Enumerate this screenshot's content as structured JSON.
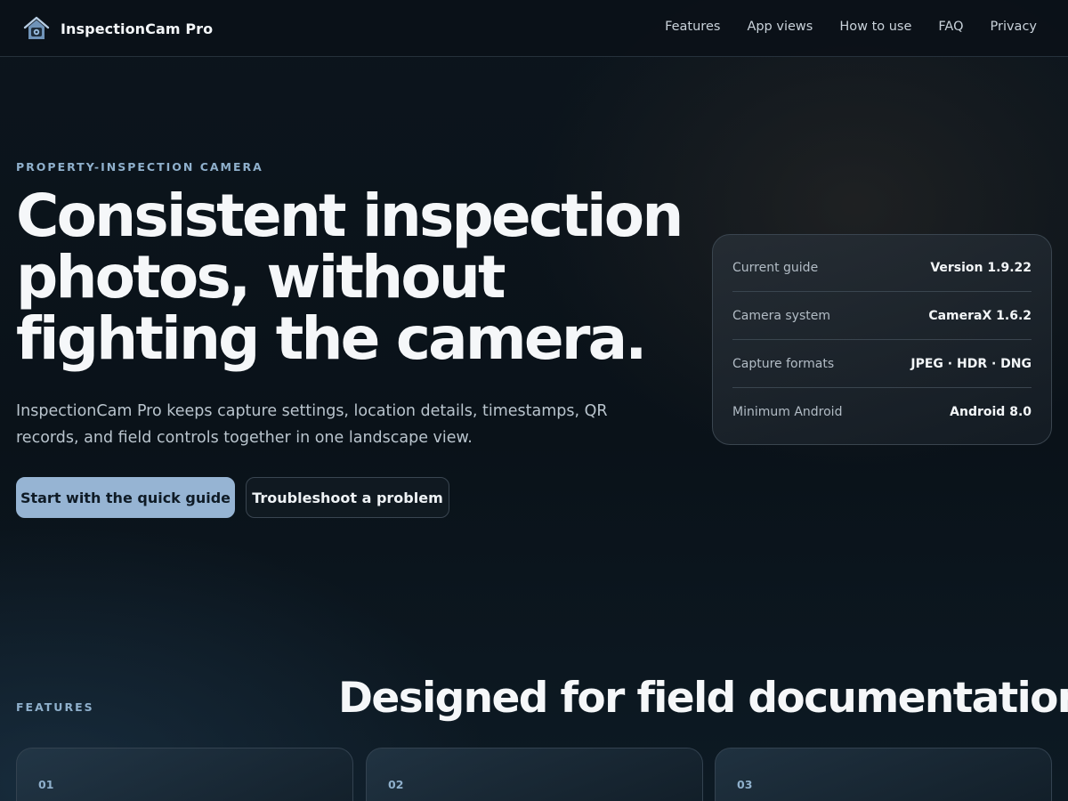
{
  "nav": {
    "brand": "InspectionCam Pro",
    "links": [
      "Features",
      "App views",
      "How to use",
      "FAQ",
      "Privacy"
    ]
  },
  "hero": {
    "eyebrow": "PROPERTY-INSPECTION CAMERA",
    "title_lines": [
      "Consistent inspection",
      "photos, without",
      "fighting the camera."
    ],
    "subtitle": "InspectionCam Pro keeps capture settings, location details, timestamps, QR records, and field controls together in one landscape view.",
    "primary_button": "Start with the quick guide",
    "secondary_button": "Troubleshoot a problem"
  },
  "info": [
    {
      "label": "Current guide",
      "value": "Version 1.9.22"
    },
    {
      "label": "Camera system",
      "value": "CameraX 1.6.2"
    },
    {
      "label": "Capture formats",
      "value": "JPEG · HDR · DNG"
    },
    {
      "label": "Minimum Android",
      "value": "Android 8.0"
    }
  ],
  "features": {
    "eyebrow": "FEATURES",
    "title": "Designed for field documentation",
    "cards": [
      {
        "num": "01"
      },
      {
        "num": "02"
      },
      {
        "num": "03"
      }
    ]
  },
  "colors": {
    "accent": "#96b4d3",
    "background": "#0b141c",
    "eyebrow": "#8fb0cc"
  },
  "icons": {
    "brand": "house-camera-icon"
  }
}
